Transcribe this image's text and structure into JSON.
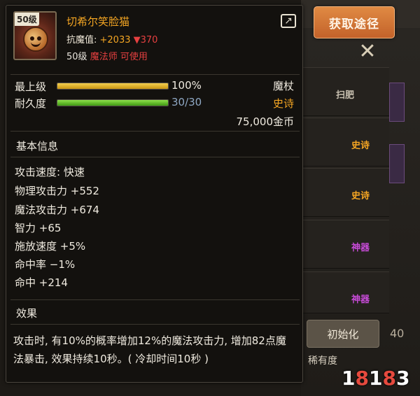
{
  "item": {
    "level_badge": "50级",
    "name": "切希尔笑脸猫",
    "resist_label": "抗魔值: ",
    "resist_value": "+2033",
    "resist_delta": "▼370",
    "req_level": "50级",
    "req_class": "魔法师 可使用",
    "icon": "cheshire-cat-icon"
  },
  "bars": {
    "top_label": "最上级",
    "top_value": "100%",
    "top_fraction": 1.0,
    "durability_label": "耐久度",
    "durability_value": "30/30",
    "durability_fraction": 1.0
  },
  "meta": {
    "type": "魔杖",
    "rarity": "史诗",
    "price": "75,000金币"
  },
  "basic": {
    "title": "基本信息",
    "lines": [
      "攻击速度: 快速",
      "物理攻击力 +552",
      "魔法攻击力 +674",
      "智力 +65",
      "施放速度 +5%",
      "命中率 −1%",
      "命中 +214"
    ]
  },
  "effect": {
    "title": "效果",
    "text": "攻击时, 有10%的概率增加12%的魔法攻击力, 增加82点魔法暴击, 效果持续10秒。( 冷却时间10秒 )"
  },
  "background": {
    "get_button": "获取途径",
    "row_tags": [
      "扫肥",
      "史诗",
      "史诗",
      "神器",
      "神器"
    ],
    "init_button": "初始化",
    "rare_text": "稀有度",
    "num": "40",
    "watermark": "18183"
  },
  "colors": {
    "epic": "#f5a623",
    "artifact": "#c64bd6",
    "bar_yellow": "#e4b020",
    "bar_green": "#5cc21c",
    "warn_red": "#e64040"
  }
}
